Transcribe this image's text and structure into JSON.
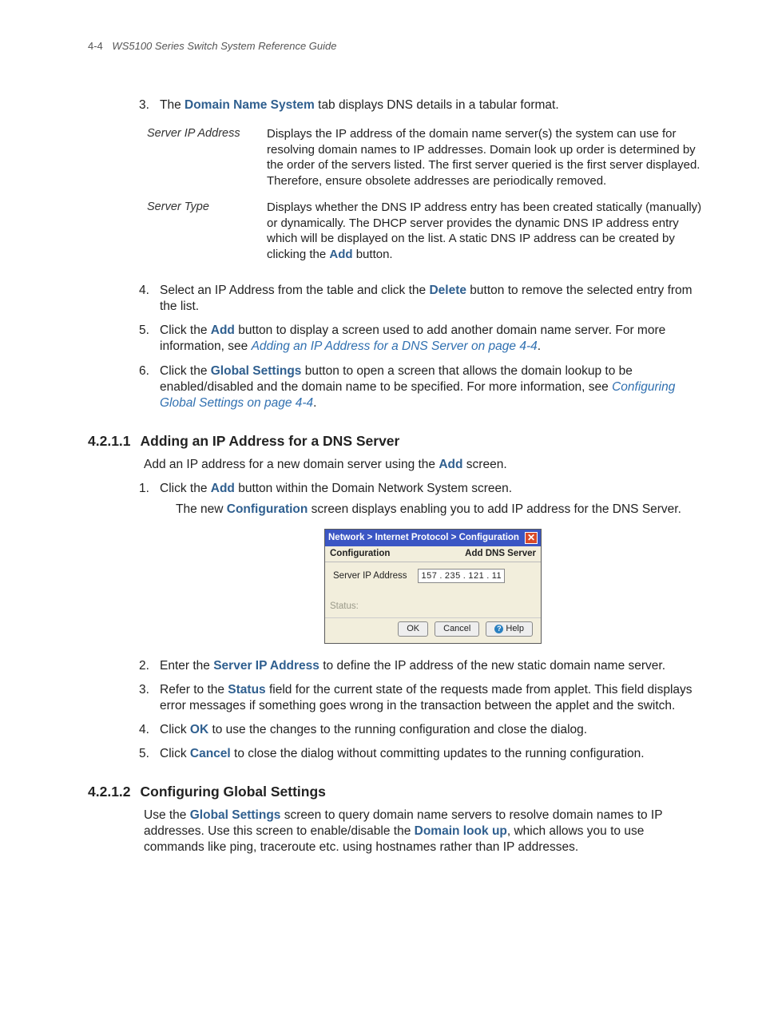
{
  "header": {
    "page_num": "4-4",
    "doc_title": "WS5100 Series Switch System Reference Guide"
  },
  "step3": {
    "num": "3.",
    "pre": "The ",
    "bold": "Domain Name System",
    "post": " tab displays DNS details in a tabular format."
  },
  "defs": {
    "row1": {
      "term": "Server IP Address",
      "def": "Displays the IP address of the domain name server(s) the system can use for resolving domain names to IP addresses. Domain look up order is determined by the order of the servers listed. The first server queried is the first server displayed. Therefore, ensure obsolete addresses are periodically removed."
    },
    "row2": {
      "term": "Server Type",
      "def_pre": "Displays whether the DNS IP address entry has been created statically (manually) or dynamically. The DHCP server provides the dynamic DNS IP address entry which will be displayed on the list. A static DNS IP address can be created by clicking the ",
      "def_bold": "Add",
      "def_post": " button."
    }
  },
  "step4": {
    "num": "4.",
    "pre": "Select an IP Address from the table and click the ",
    "bold": "Delete",
    "post": " button to remove the selected entry from the list."
  },
  "step5": {
    "num": "5.",
    "pre": "Click the ",
    "bold": "Add",
    "mid": " button to display a screen used to add another domain name server. For more information, see ",
    "link": "Adding an IP Address for a DNS Server on page 4-4",
    "end": "."
  },
  "step6": {
    "num": "6.",
    "pre": "Click the ",
    "bold": "Global Settings",
    "mid": " button to open a screen that allows the domain lookup to be enabled/disabled and the domain name to be specified. For more information, see ",
    "link": "Configuring Global Settings on page 4-4",
    "end": "."
  },
  "sec1": {
    "num": "4.2.1.1",
    "title": "Adding an IP Address for a DNS Server",
    "intro_pre": "Add an IP address for a new domain server using the ",
    "intro_bold": "Add",
    "intro_post": " screen.",
    "s1": {
      "num": "1.",
      "pre": "Click the ",
      "bold": "Add",
      "post": " button within the Domain Network System screen."
    },
    "s1_sub_pre": "The new ",
    "s1_sub_bold": "Configuration",
    "s1_sub_post": " screen displays enabling you to add IP address for the DNS Server.",
    "s2": {
      "num": "2.",
      "pre": "Enter the ",
      "bold": "Server IP Address",
      "post": " to define the IP address of the new static domain name server."
    },
    "s3": {
      "num": "3.",
      "pre": "Refer to the ",
      "bold": "Status",
      "post": " field for the current state of the requests made from applet. This field displays error messages if something goes wrong in the transaction between the applet and the switch."
    },
    "s4": {
      "num": "4.",
      "pre": "Click ",
      "bold": "OK",
      "post": " to use the changes to the running configuration and close the dialog."
    },
    "s5": {
      "num": "5.",
      "pre": "Click ",
      "bold": "Cancel",
      "post": " to close the dialog without committing updates to the running configuration."
    }
  },
  "dialog": {
    "breadcrumb": "Network > Internet Protocol > Configuration",
    "close_glyph": "✕",
    "left_label": "Configuration",
    "right_label": "Add DNS Server",
    "field_label": "Server IP Address",
    "ip1": "157",
    "ip2": "235",
    "ip3": "121",
    "ip4": "11",
    "dot": ".",
    "status_label": "Status:",
    "btn_ok": "OK",
    "btn_cancel": "Cancel",
    "btn_help": "Help",
    "help_glyph": "?"
  },
  "sec2": {
    "num": "4.2.1.2",
    "title": "Configuring Global Settings",
    "p_pre": "Use the ",
    "p_bold1": "Global Settings",
    "p_mid1": " screen to query domain name servers to resolve domain names to IP addresses. Use this screen to enable/disable the ",
    "p_bold2": "Domain look up",
    "p_post": ", which allows you to use commands like ping, traceroute etc. using hostnames rather than IP addresses."
  }
}
